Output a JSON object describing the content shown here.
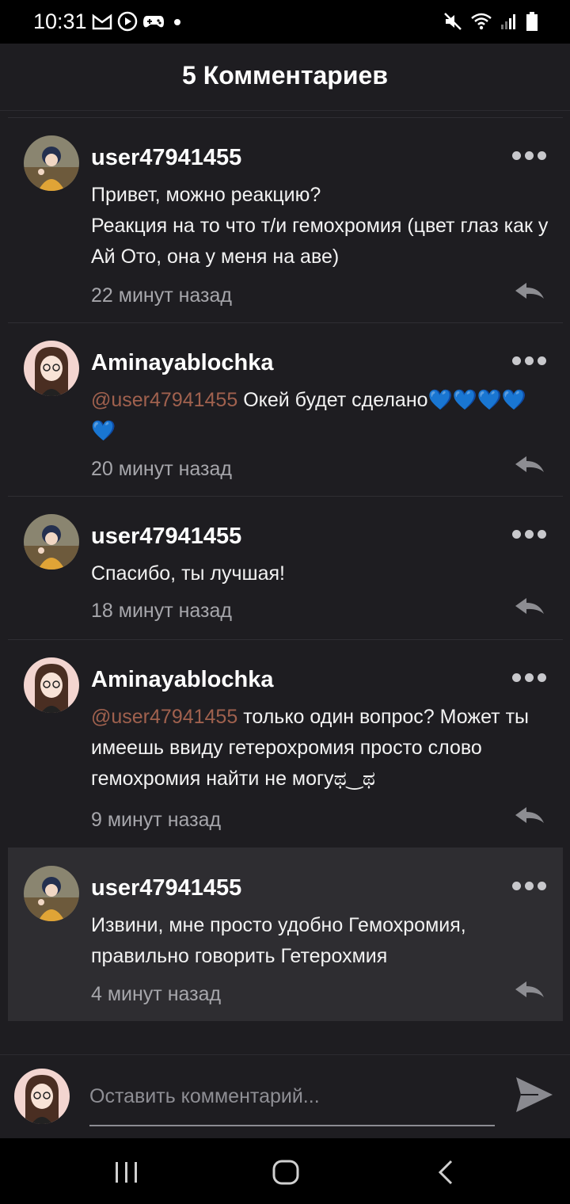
{
  "status_bar": {
    "time": "10:31",
    "left_icons": [
      "gmail-icon",
      "media-icon",
      "gamepad-icon",
      "dot-icon"
    ],
    "right_icons": [
      "mute-icon",
      "wifi-icon",
      "signal-icon",
      "battery-icon"
    ]
  },
  "header": {
    "title": "5 Комментариев"
  },
  "comments": [
    {
      "user": "user47941455",
      "mention": "",
      "text": "Привет, можно реакцию?\nРеакция на то что т/и гемохромия (цвет глаз как у Ай Ото, она у меня на аве)",
      "time": "22 минут назад",
      "avatar": "avatar-user47941455"
    },
    {
      "user": "Aminayablochka",
      "mention": "@user47941455",
      "text": " Окей будет сделано💙💙💙💙💙",
      "time": "20 минут назад",
      "avatar": "avatar-aminayablochka"
    },
    {
      "user": "user47941455",
      "mention": "",
      "text": "Спасибо, ты лучшая!",
      "time": "18 минут назад",
      "avatar": "avatar-user47941455"
    },
    {
      "user": "Aminayablochka",
      "mention": "@user47941455",
      "text": " только один вопрос? Может ты имеешь ввиду гетерохромия просто слово гемохромия найти не могуಥ‿ಥ",
      "time": "9 минут назад",
      "avatar": "avatar-aminayablochka"
    },
    {
      "user": "user47941455",
      "mention": "",
      "text": "Извини, мне просто удобно Гемохромия, правильно говорить Гетерохмия",
      "time": "4 минут назад",
      "avatar": "avatar-user47941455"
    }
  ],
  "composer": {
    "placeholder": "Оставить комментарий..."
  },
  "nav_bar": {
    "buttons": [
      "recent-apps-icon",
      "home-icon",
      "back-icon"
    ]
  },
  "colors": {
    "mention": "#a0614e",
    "background": "#1e1d21",
    "highlight": "#2e2d31"
  }
}
